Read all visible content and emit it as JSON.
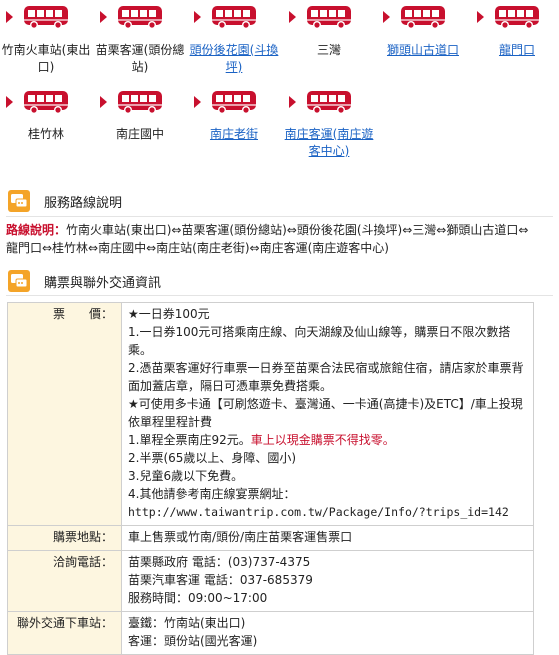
{
  "stops": [
    {
      "label": "竹南火車站(東出口)",
      "link": false
    },
    {
      "label": "苗栗客運(頭份總站)",
      "link": false
    },
    {
      "label": "頭份後花園(斗換坪)",
      "link": true
    },
    {
      "label": "三灣",
      "link": false
    },
    {
      "label": "獅頭山古道口",
      "link": true
    },
    {
      "label": "龍門口",
      "link": true
    },
    {
      "label": "桂竹林",
      "link": false
    },
    {
      "label": "南庄國中",
      "link": false
    },
    {
      "label": "南庄老街",
      "link": true
    },
    {
      "label": "南庄客運(南庄遊客中心)",
      "link": true
    }
  ],
  "route_section": {
    "title": "服務路線說明"
  },
  "route_desc": {
    "label": "路線說明：",
    "text": "竹南火車站(東出口)⇔苗栗客運(頭份總站)⇔頭份後花園(斗換坪)⇔三灣⇔獅頭山古道口⇔龍門口⇔桂竹林⇔南庄國中⇔南庄站(南庄老街)⇔南庄客運(南庄遊客中心)"
  },
  "ticket_section": {
    "title": "購票與聯外交通資訊"
  },
  "table": {
    "price": {
      "label": "票　　價：",
      "lines": [
        "★一日券100元",
        "1.一日券100元可搭乘南庄線、向天湖線及仙山線等，購票日不限次數搭乘。",
        "2.憑苗栗客運好行車票一日券至苗栗合法民宿或旅館住宿，請店家於車票背面加蓋店章，隔日可憑車票免費搭乘。",
        "★可使用多卡通【可刷悠遊卡、臺灣通、一卡通(高捷卡)及ETC】/車上投現依單程里程計費",
        "1.單程全票南庄92元。"
      ],
      "red_note": "車上以現金購票不得找零。",
      "lines2": [
        "2.半票(65歲以上、身障、國小)",
        "3.兒童6歲以下免費。",
        "4.其他請參考南庄線宴票網址："
      ],
      "url": "http://www.taiwantrip.com.tw/Package/Info/?trips_id=142"
    },
    "where": {
      "label": "購票地點：",
      "value": "車上售票或竹南/頭份/南庄苗栗客運售票口"
    },
    "contact": {
      "label": "洽詢電話：",
      "lines": [
        "苗栗縣政府 電話：(03)737-4375",
        "苗栗汽車客運 電話：037-685379",
        "服務時間：09:00~17:00"
      ]
    },
    "transfer": {
      "label": "聯外交通下車站：",
      "lines": [
        "臺鐵：竹南站(東出口)",
        "客運：頭份站(國光客運)"
      ]
    }
  },
  "colors": {
    "bus": "#c8102e",
    "accent": "#f4a428",
    "label_bg": "#fdf6e0",
    "link": "#1a62c4"
  }
}
